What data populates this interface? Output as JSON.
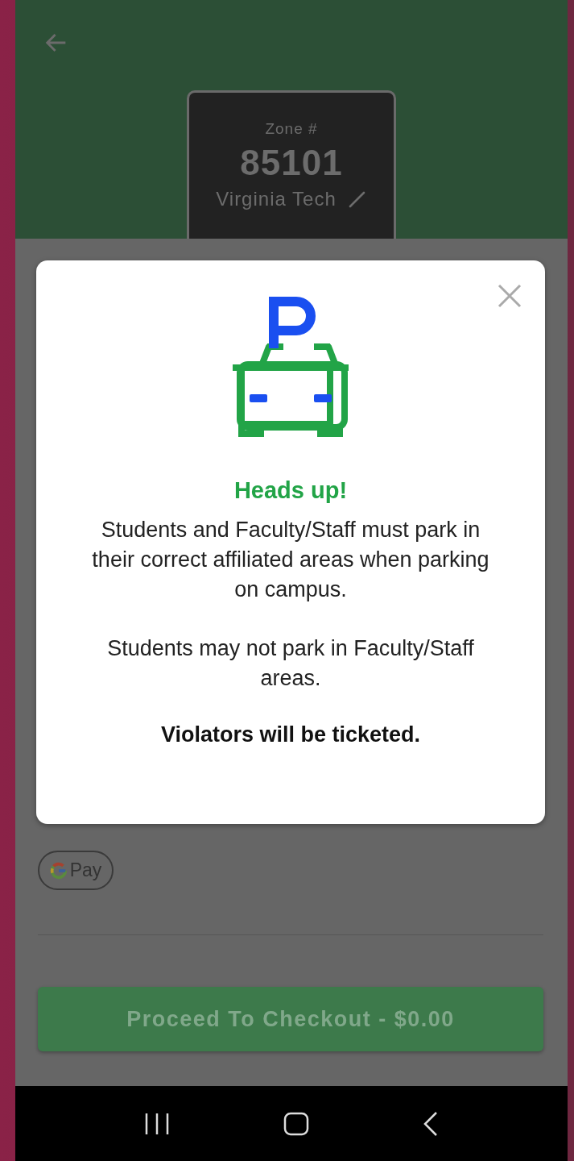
{
  "zone": {
    "label": "Zone #",
    "number": "85101",
    "name": "Virginia Tech"
  },
  "modal": {
    "title": "Heads up!",
    "paragraphs": [
      "Students and Faculty/Staff must park in their correct affiliated areas when parking on campus.",
      "Students may not park in Faculty/Staff areas."
    ],
    "warning": "Violators will be ticketed."
  },
  "payment": {
    "wallet_label": "Pay"
  },
  "checkout": {
    "label": "Proceed To Checkout - $0.00"
  }
}
